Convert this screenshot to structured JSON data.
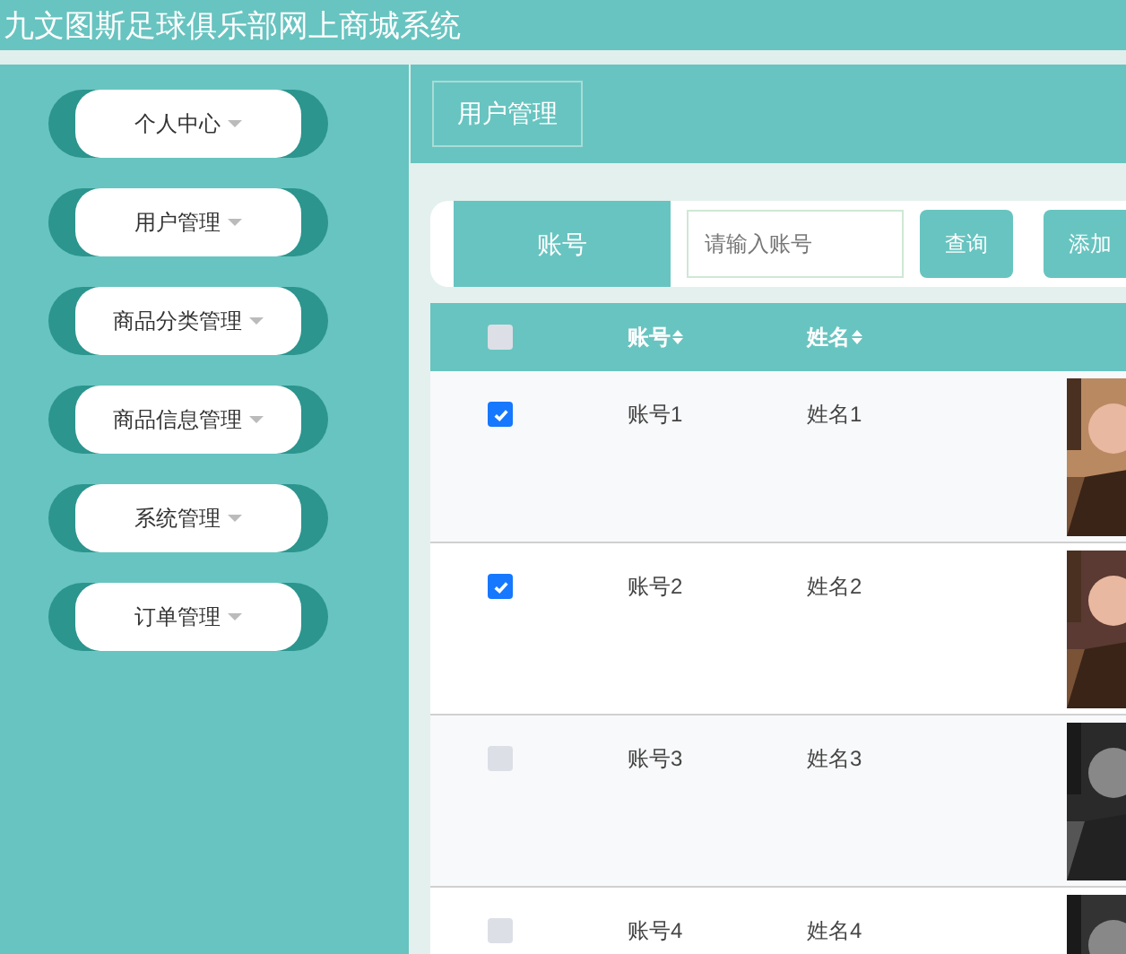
{
  "header": {
    "title": "九文图斯足球俱乐部网上商城系统"
  },
  "sidebar": {
    "items": [
      {
        "label": "个人中心"
      },
      {
        "label": "用户管理"
      },
      {
        "label": "商品分类管理"
      },
      {
        "label": "商品信息管理"
      },
      {
        "label": "系统管理"
      },
      {
        "label": "订单管理"
      }
    ]
  },
  "breadcrumb": {
    "tab": "用户管理"
  },
  "search": {
    "label": "账号",
    "placeholder": "请输入账号",
    "buttons": [
      "查询",
      "添加"
    ]
  },
  "table": {
    "header_checked": false,
    "columns": [
      "账号",
      "姓名"
    ],
    "rows": [
      {
        "checked": true,
        "cells": [
          "账号1",
          "姓名1"
        ],
        "kind": "picture"
      },
      {
        "checked": true,
        "cells": [
          "账号2",
          "姓名2"
        ],
        "kind": "picture"
      },
      {
        "checked": false,
        "cells": [
          "账号3",
          "姓名3"
        ],
        "kind": "picture"
      },
      {
        "checked": false,
        "cells": [
          "账号4",
          "姓名4"
        ],
        "kind": "picture"
      }
    ]
  }
}
